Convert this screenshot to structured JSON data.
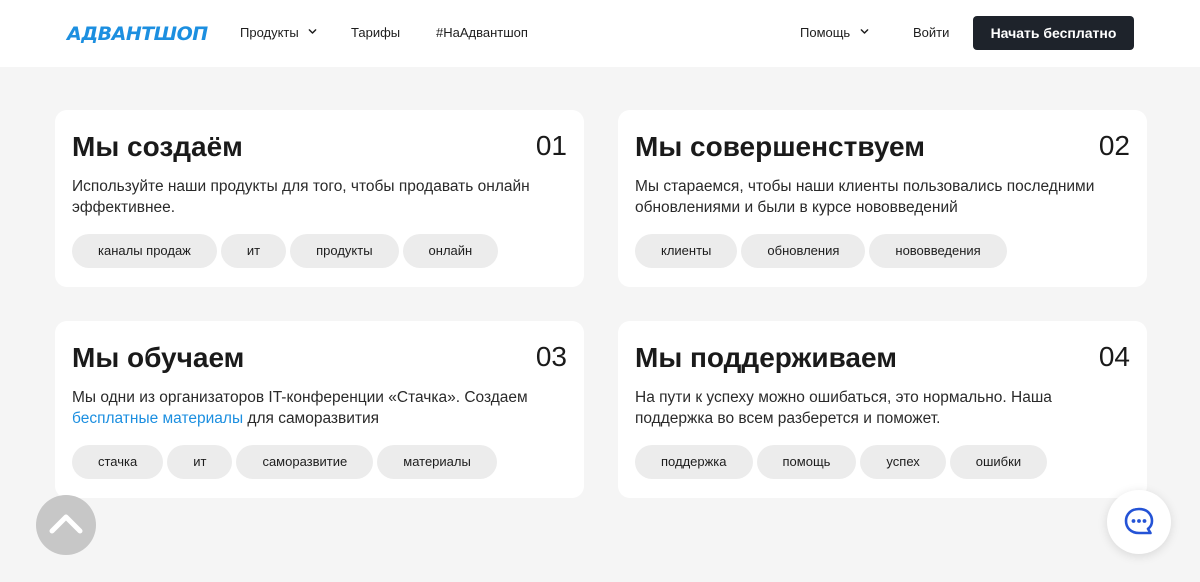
{
  "header": {
    "logo": "АДВАНТШОП",
    "nav": [
      {
        "label": "Продукты",
        "has_dropdown": true
      },
      {
        "label": "Тарифы"
      },
      {
        "label": "#НаАдвантшоп"
      }
    ],
    "help_label": "Помощь",
    "login_label": "Войти",
    "cta_label": "Начать бесплатно"
  },
  "cards": [
    {
      "title": "Мы создаём",
      "number": "01",
      "desc": "Используйте наши продукты для того, чтобы продавать онлайн эффективнее.",
      "tags": [
        "каналы продаж",
        "ит",
        "продукты",
        "онлайн"
      ]
    },
    {
      "title": "Мы совершенствуем",
      "number": "02",
      "desc": "Мы стараемся, чтобы наши клиенты пользовались последними обновлениями и были в курсе нововведений",
      "tags": [
        "клиенты",
        "обновления",
        "нововведения"
      ]
    },
    {
      "title": "Мы обучаем",
      "number": "03",
      "desc_before": "Мы одни из организаторов IT-конференции «Стачка». Создаем ",
      "desc_link": "бесплатные материалы",
      "desc_after": " для саморазвития",
      "tags": [
        "стачка",
        "ит",
        "саморазвитие",
        "материалы"
      ]
    },
    {
      "title": "Мы поддерживаем",
      "number": "04",
      "desc": "На пути к успеху можно ошибаться, это нормально. Наша поддержка во всем разберется и поможет.",
      "tags": [
        "поддержка",
        "помощь",
        "успех",
        "ошибки"
      ]
    }
  ],
  "floating": {
    "scroll_top_icon": "chevron-up-icon",
    "chat_icon": "chat-bubble-icon"
  },
  "colors": {
    "accent": "#1c8fe0",
    "cta_bg": "#1e232b",
    "page_bg": "#f5f5f5",
    "tag_bg": "#ececec"
  }
}
